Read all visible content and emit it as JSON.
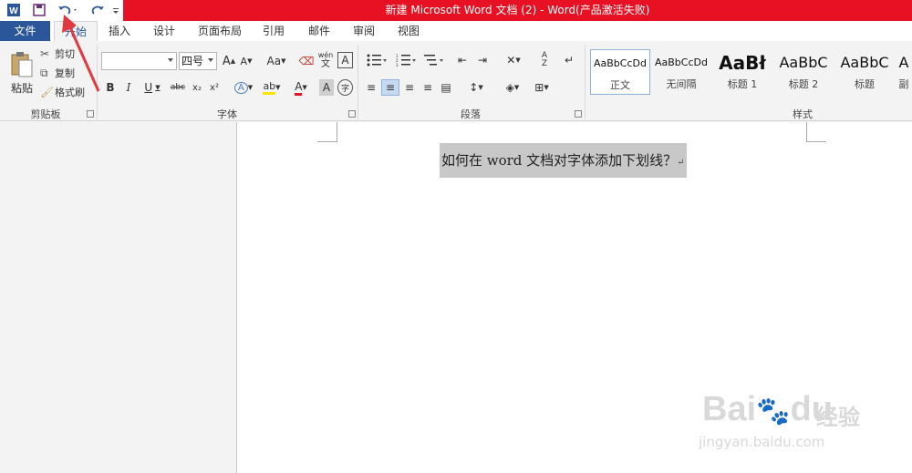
{
  "window": {
    "title": "新建 Microsoft Word 文档 (2) -  Word(产品激活失败)",
    "accent": "#e81123",
    "brand": "#2b579a"
  },
  "quick_access": {
    "word_icon": "W",
    "save_icon": "save-icon",
    "undo_icon": "undo-icon",
    "redo_icon": "redo-icon",
    "customize_icon": "customize-icon"
  },
  "tabs": {
    "file": "文件",
    "home": "开始",
    "insert": "插入",
    "design": "设计",
    "layout": "页面布局",
    "references": "引用",
    "mailings": "邮件",
    "review": "审阅",
    "view": "视图"
  },
  "clipboard": {
    "paste": "粘贴",
    "cut": "剪切",
    "copy": "复制",
    "format_painter": "格式刷",
    "group": "剪贴板"
  },
  "font": {
    "font_name": "",
    "font_size": "四号",
    "grow": "A",
    "shrink": "A",
    "change_case": "Aa",
    "wen": "wén",
    "wen_char": "文",
    "border_char": "A",
    "bold": "B",
    "italic": "I",
    "underline": "U",
    "strike": "abc",
    "subscript": "x₂",
    "superscript": "x²",
    "text_effect": "A",
    "highlight": "ab",
    "font_color": "A",
    "char_shade": "A",
    "enclose": "字",
    "group": "字体"
  },
  "paragraph": {
    "group": "段落"
  },
  "styles": {
    "group": "样式",
    "items": [
      {
        "sample": "AaBbCcDd",
        "name": "正文"
      },
      {
        "sample": "AaBbCcDd",
        "name": "无间隔"
      },
      {
        "sample": "AaBł",
        "name": "标题 1"
      },
      {
        "sample": "AaBbC",
        "name": "标题 2"
      },
      {
        "sample": "AaBbC",
        "name": "标题"
      },
      {
        "sample": "A",
        "name": "副"
      }
    ]
  },
  "document": {
    "text": "如何在 word 文档对字体添加下划线？",
    "para_mark": "↵"
  },
  "watermark": {
    "brand": "Bai",
    "brand_du": "du",
    "cn": "经验",
    "url": "jingyan.baidu.com"
  }
}
